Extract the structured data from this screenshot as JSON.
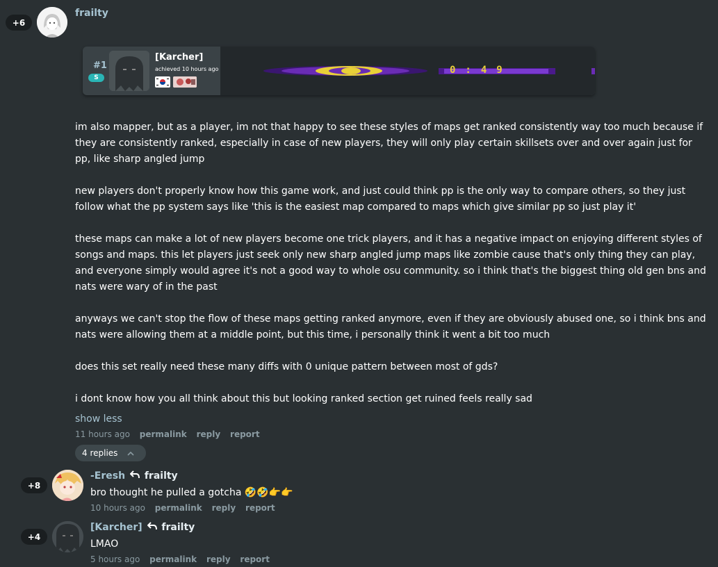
{
  "root": {
    "votes": "+6",
    "username": "frailty",
    "paragraphs": [
      "im also mapper, but as a player, im not that happy to see these styles of maps get ranked consistently way too much because if they are consistently ranked, especially in case of new players, they will only play certain skillsets over and over again just for pp, like sharp angled jump",
      "new players don't properly know how this game work, and just could think pp is the only way to compare others, so they just follow what the pp system says like 'this is the easiest map compared to maps which give similar pp so just play it'",
      "these maps can make a lot of new players become one trick players, and it has a negative impact on enjoying different styles of songs and maps. this let players just seek only new sharp angled jump maps like zombie cause that's only thing they can play, and everyone simply would agree it's not a good way to whole osu community. so i think that's the biggest thing old gen bns and nats were wary of in the past",
      "anyways we can't stop the flow of these maps getting ranked anymore, even if they are obviously abused one, so i think bns and nats were allowing them at a middle point, but this time, i personally think it went a bit too much",
      "does this set really need these many diffs with 0 unique pattern between most of gds?",
      "i dont know how you all think about this but looking ranked section get ruined feels really sad"
    ],
    "show_less": "show less",
    "time": "11 hours ago",
    "permalink": "permalink",
    "reply": "reply",
    "report": "report",
    "replies_toggle": "4 replies"
  },
  "score_card": {
    "rank": "#1",
    "grade": "S",
    "player": "[Karcher]",
    "achieved": "achieved 10 hours ago",
    "banner_text": "0:49"
  },
  "replies": [
    {
      "votes": "+8",
      "username": "-Eresh",
      "reply_to": "frailty",
      "text": "bro thought he pulled a gotcha 🤣🤣👉👉",
      "time": "10 hours ago",
      "permalink": "permalink",
      "reply": "reply",
      "report": "report"
    },
    {
      "votes": "+4",
      "username": "[Karcher]",
      "reply_to": "frailty",
      "text": "LMAO",
      "time": "5 hours ago",
      "permalink": "permalink",
      "reply": "reply",
      "report": "report"
    }
  ],
  "colors": {
    "background": "#2a3033",
    "username": "#a6c3d1",
    "grade_badge": "#2ab5b5",
    "banner_purple": "#4a1a8c",
    "banner_yellow": "#e8d038"
  },
  "icons": {
    "reply_arrow": "reply-arrow-icon",
    "chevron": "chevron-up-icon"
  }
}
